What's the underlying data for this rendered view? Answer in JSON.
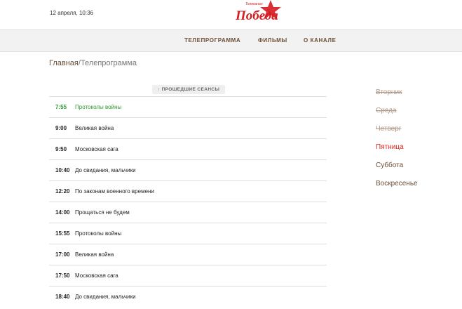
{
  "header": {
    "datetime": "12 апреля, 10:36",
    "logo": {
      "label_small": "Телеканал",
      "label_main": "Победа",
      "color": "#d61a1f"
    }
  },
  "nav": {
    "items": [
      {
        "label": "ТЕЛЕПРОГРАММА"
      },
      {
        "label": "ФИЛЬМЫ"
      },
      {
        "label": "О КАНАЛЕ"
      }
    ]
  },
  "breadcrumb": {
    "home": "Главная",
    "separator": "/",
    "current": "Телепрограмма"
  },
  "past_sessions_button": {
    "icon": "arrow-up-icon",
    "label": "↑ ПРОШЕДШИЕ СЕАНСЫ"
  },
  "schedule": {
    "current_progress": 0.64,
    "items": [
      {
        "time": "7:55",
        "title": "Протоколы войны",
        "current": true
      },
      {
        "time": "9:00",
        "title": "Великая война"
      },
      {
        "time": "9:50",
        "title": "Московская сага"
      },
      {
        "time": "10:40",
        "title": "До свидания, мальчики"
      },
      {
        "time": "12:20",
        "title": "По законам военного времени"
      },
      {
        "time": "14:00",
        "title": "Прощаться не будем"
      },
      {
        "time": "15:55",
        "title": "Протоколы войны"
      },
      {
        "time": "17:00",
        "title": "Великая война"
      },
      {
        "time": "17:50",
        "title": "Московская сага"
      },
      {
        "time": "18:40",
        "title": "До свидания, мальчики"
      }
    ]
  },
  "days": [
    {
      "label": "Вторник",
      "state": "past"
    },
    {
      "label": "Среда",
      "state": "past"
    },
    {
      "label": "Четверг",
      "state": "past"
    },
    {
      "label": "Пятница",
      "state": "today"
    },
    {
      "label": "Суббота",
      "state": "future"
    },
    {
      "label": "Воскресенье",
      "state": "future"
    }
  ],
  "colors": {
    "accent_green": "#2d9a2d",
    "today_red": "#e0241c",
    "brown": "#6b4e36",
    "past_day": "#b09a88"
  }
}
